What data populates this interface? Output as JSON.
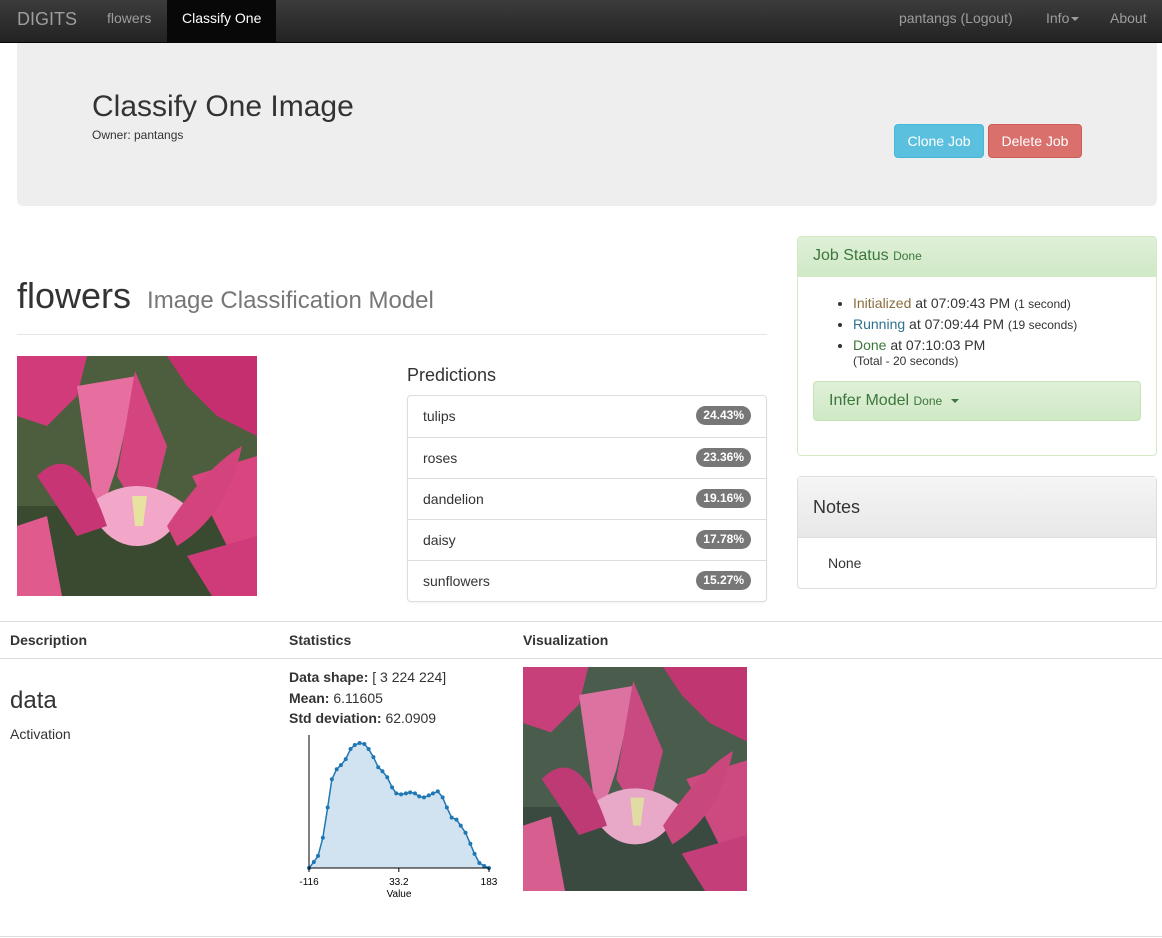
{
  "navbar": {
    "brand": "DIGITS",
    "links": [
      "flowers",
      "Classify One"
    ],
    "user": "pantangs (Logout)",
    "info": "Info",
    "about": "About"
  },
  "header": {
    "title": "Classify One Image",
    "owner": "Owner: pantangs",
    "clone_label": "Clone Job",
    "delete_label": "Delete Job"
  },
  "model": {
    "name": "flowers",
    "type": "Image Classification Model"
  },
  "predictions": {
    "title": "Predictions",
    "items": [
      {
        "label": "tulips",
        "pct": "24.43%"
      },
      {
        "label": "roses",
        "pct": "23.36%"
      },
      {
        "label": "dandelion",
        "pct": "19.16%"
      },
      {
        "label": "daisy",
        "pct": "17.78%"
      },
      {
        "label": "sunflowers",
        "pct": "15.27%"
      }
    ]
  },
  "job_status": {
    "title": "Job Status",
    "state": "Done",
    "entries": [
      {
        "status": "Initialized",
        "time": "at 07:09:43 PM",
        "duration": "(1 second)"
      },
      {
        "status": "Running",
        "time": "at 07:09:44 PM",
        "duration": "(19 seconds)"
      },
      {
        "status": "Done",
        "time": "at 07:10:03 PM",
        "duration": ""
      }
    ],
    "total": "(Total - 20 seconds)",
    "infer_label": "Infer Model",
    "infer_state": "Done"
  },
  "notes": {
    "title": "Notes",
    "body": "None"
  },
  "table": {
    "headers": [
      "Description",
      "Statistics",
      "Visualization"
    ],
    "layer": {
      "name": "data",
      "type": "Activation",
      "shape_label": "Data shape:",
      "shape": "[ 3 224 224]",
      "mean_label": "Mean:",
      "mean": "6.11605",
      "std_label": "Std deviation:",
      "std": "62.0909"
    }
  },
  "chart_data": {
    "type": "area",
    "xlabel": "Value",
    "tick_labels": [
      "-116",
      "33.2",
      "183"
    ],
    "xlim": [
      -116,
      183
    ],
    "x": [
      -116,
      -108,
      -101,
      -93,
      -85,
      -78,
      -70,
      -63,
      -55,
      -47,
      -40,
      -32,
      -24,
      -17,
      -9,
      -1,
      6,
      14,
      22,
      29,
      37,
      45,
      52,
      60,
      67,
      75,
      83,
      90,
      98,
      106,
      113,
      121,
      129,
      136,
      144,
      152,
      159,
      167,
      175,
      183
    ],
    "y": [
      0,
      6,
      12,
      30,
      60,
      88,
      98,
      102,
      108,
      118,
      122,
      124,
      123,
      118,
      110,
      100,
      96,
      90,
      80,
      74,
      73,
      74,
      75,
      74,
      71,
      70,
      72,
      74,
      76,
      70,
      60,
      50,
      48,
      42,
      35,
      24,
      14,
      5,
      2,
      0
    ]
  },
  "colors": {
    "navbar_bg": "#222222",
    "success": "#3c763d",
    "info_btn": "#5bc0de",
    "danger_btn": "#d9706c",
    "badge": "#777777",
    "chart_line": "#1f77b4",
    "chart_fill": "#d1e3f0"
  }
}
